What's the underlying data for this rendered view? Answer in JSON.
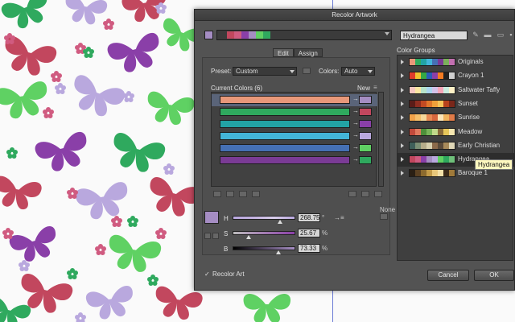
{
  "dialog": {
    "title": "Recolor Artwork",
    "group_name": "Hydrangea",
    "tabs": [
      {
        "label": "Edit"
      },
      {
        "label": "Assign"
      }
    ],
    "preset_label": "Preset:",
    "preset_value": "Custom",
    "colors_label": "Colors:",
    "colors_value": "Auto",
    "current_colors_label": "Current Colors (6)",
    "new_label": "New",
    "none_label": "None",
    "hsb": [
      {
        "name": "H",
        "value": "268.75",
        "unit": "°",
        "level": 0.75
      },
      {
        "name": "S",
        "value": "25.67",
        "unit": "%",
        "level": 0.26
      },
      {
        "name": "B",
        "value": "73.33",
        "unit": "%",
        "level": 0.73
      }
    ],
    "recolor_art_label": "Recolor Art",
    "cancel_label": "Cancel",
    "ok_label": "OK",
    "color_groups_label": "Color Groups",
    "tooltip": "Hydrangea"
  },
  "current_colors": [
    {
      "current": "#e8987a",
      "new": "#a58dc3",
      "selected": true
    },
    {
      "current": "#2fa95e",
      "new": "#c2475e",
      "selected": false
    },
    {
      "current": "#22a3a5",
      "new": "#8a3fa8",
      "selected": false
    },
    {
      "current": "#43b5d8",
      "new": "#b9a8de",
      "selected": false
    },
    {
      "current": "#4570b4",
      "new": "#5fd163",
      "selected": false
    },
    {
      "current": "#7a3b95",
      "new": "#2fa95e",
      "selected": false
    }
  ],
  "top_strip_colors": [
    "#c2475e",
    "#d05b80",
    "#8a3fa8",
    "#a58dc3",
    "#5fd163",
    "#2fa95e"
  ],
  "color_groups": [
    {
      "name": "Originals",
      "colors": [
        "#e8987a",
        "#2fa95e",
        "#22a3a5",
        "#43b5d8",
        "#4570b4",
        "#7a3b95",
        "#7ab05a",
        "#c26fb0"
      ],
      "selected": false
    },
    {
      "name": "Crayon 1",
      "colors": [
        "#e03b2b",
        "#f2c230",
        "#35a844",
        "#2a5db8",
        "#8a3fa8",
        "#f57c22",
        "#222222",
        "#cfcfcf"
      ],
      "selected": false
    },
    {
      "name": "Saltwater Taffy",
      "colors": [
        "#f7c7c1",
        "#fbe6a2",
        "#b7e3c9",
        "#a9d5ee",
        "#d3c1e8",
        "#f5a6b8",
        "#c9ecdf",
        "#fff1c7"
      ],
      "selected": false
    },
    {
      "name": "Sunset",
      "colors": [
        "#5a1c18",
        "#8e2d20",
        "#c24a22",
        "#e0762b",
        "#f1a03a",
        "#f6c45a",
        "#b7411c",
        "#7a271a"
      ],
      "selected": false
    },
    {
      "name": "Sunrise",
      "colors": [
        "#f2a34a",
        "#f6c06b",
        "#f8d99a",
        "#e98a54",
        "#d8683e",
        "#fbe5b8",
        "#f0b35e",
        "#e07b48"
      ],
      "selected": false
    },
    {
      "name": "Meadow",
      "colors": [
        "#c24a3c",
        "#e07a5f",
        "#4e8f3a",
        "#79b45a",
        "#c0d88a",
        "#8a6a3a",
        "#e6c65a",
        "#f6e7b0"
      ],
      "selected": false
    },
    {
      "name": "Early Christian",
      "colors": [
        "#3f5f5a",
        "#7b8f75",
        "#b6ac8a",
        "#d7cfae",
        "#8c6a4a",
        "#5a4a3a",
        "#a88a5a",
        "#e0d8b8"
      ],
      "selected": false
    },
    {
      "name": "Hydrangea",
      "colors": [
        "#c2475e",
        "#d05b80",
        "#8a3fa8",
        "#a58dc3",
        "#b9a8de",
        "#5fd163",
        "#2fa95e",
        "#6fc07a"
      ],
      "selected": true
    },
    {
      "name": "Baroque 1",
      "colors": [
        "#2a1f14",
        "#5a4022",
        "#8c6a2e",
        "#c29a48",
        "#e8c77a",
        "#f3e0a8",
        "#3c2a18",
        "#a07a3a"
      ],
      "selected": false
    }
  ],
  "colors": {
    "dialog_bg": "#535353",
    "selected_row": "#5a6479"
  }
}
